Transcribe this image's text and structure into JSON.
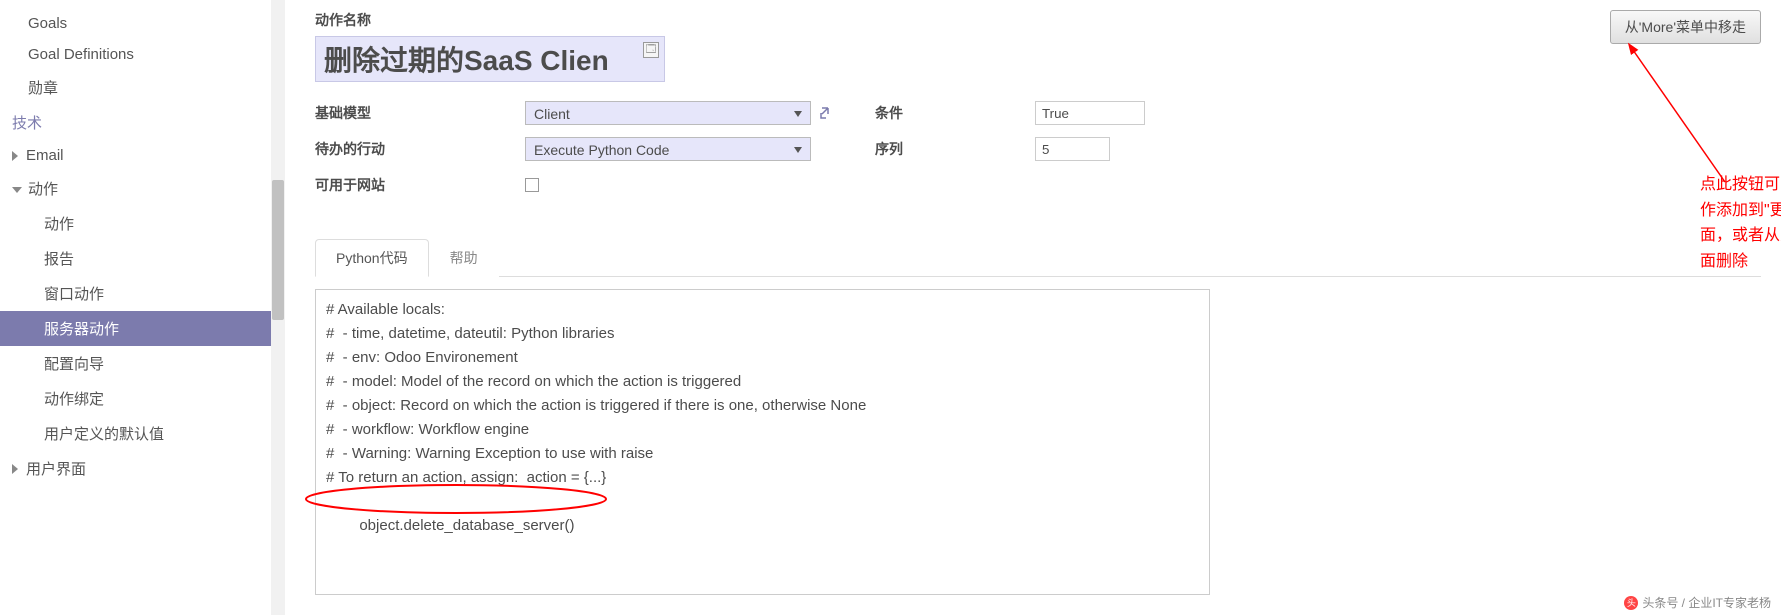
{
  "sidebar": {
    "items": [
      {
        "label": "Goals",
        "caret": false,
        "indent": 0
      },
      {
        "label": "Goal Definitions",
        "caret": false,
        "indent": 0
      },
      {
        "label": "勋章",
        "caret": false,
        "indent": 0
      }
    ],
    "section_tech": "技术",
    "tech_items": [
      {
        "label": "Email",
        "caret": "right",
        "indent": 0
      },
      {
        "label": "动作",
        "caret": "down",
        "indent": 0
      },
      {
        "label": "动作",
        "caret": false,
        "indent": 1
      },
      {
        "label": "报告",
        "caret": false,
        "indent": 1
      },
      {
        "label": "窗口动作",
        "caret": false,
        "indent": 1
      },
      {
        "label": "服务器动作",
        "caret": false,
        "indent": 1,
        "active": true
      },
      {
        "label": "配置向导",
        "caret": false,
        "indent": 1
      },
      {
        "label": "动作绑定",
        "caret": false,
        "indent": 1
      },
      {
        "label": "用户定义的默认值",
        "caret": false,
        "indent": 1
      },
      {
        "label": "用户界面",
        "caret": "right",
        "indent": 0
      }
    ]
  },
  "main": {
    "title_label": "动作名称",
    "title_value": "删除过期的SaaS Clien",
    "remove_btn": "从'More'菜单中移走",
    "fields": {
      "base_model_label": "基础模型",
      "base_model_value": "Client",
      "todo_label": "待办的行动",
      "todo_value": "Execute Python Code",
      "website_label": "可用于网站",
      "cond_label": "条件",
      "cond_value": "True",
      "seq_label": "序列",
      "seq_value": "5"
    },
    "tabs": {
      "t1": "Python代码",
      "t2": "帮助"
    },
    "code_lines": [
      "# Available locals:",
      "#  - time, datetime, dateutil: Python libraries",
      "#  - env: Odoo Environement",
      "#  - model: Model of the record on which the action is triggered",
      "#  - object: Record on which the action is triggered if there is one, otherwise None",
      "#  - workflow: Workflow engine",
      "#  - Warning: Warning Exception to use with raise",
      "# To return an action, assign:  action = {...}",
      "object.delete_database_server()"
    ],
    "annotation": "点此按钮可以将动作添加到\"更多\"下面，或者从更多里面删除",
    "watermark": "头条号 / 企业IT专家老杨"
  }
}
